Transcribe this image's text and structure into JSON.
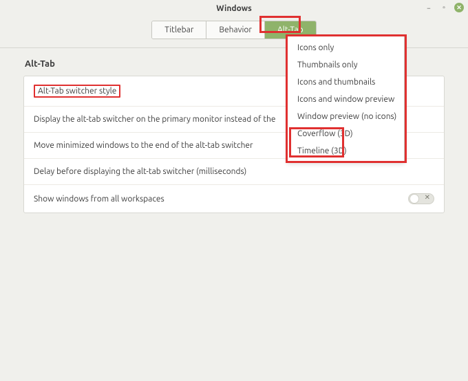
{
  "window": {
    "title": "Windows"
  },
  "tabs": {
    "titlebar": "Titlebar",
    "behavior": "Behavior",
    "alttab": "Alt-Tab"
  },
  "section": {
    "heading": "Alt-Tab"
  },
  "rows": {
    "style_label": "Alt-Tab switcher style",
    "primary_monitor": "Display the alt-tab switcher on the primary monitor instead of the",
    "move_minimized": "Move minimized windows to the end of the alt-tab switcher",
    "delay": "Delay before displaying the alt-tab switcher (milliseconds)",
    "all_workspaces": "Show windows from all workspaces"
  },
  "dropdown": {
    "icons_only": "Icons only",
    "thumbnails_only": "Thumbnails only",
    "icons_thumbnails": "Icons and thumbnails",
    "icons_window_preview": "Icons and window preview",
    "window_preview_no_icons": "Window preview (no icons)",
    "coverflow_3d": "Coverflow (3D)",
    "timeline_3d": "Timeline (3D)"
  }
}
